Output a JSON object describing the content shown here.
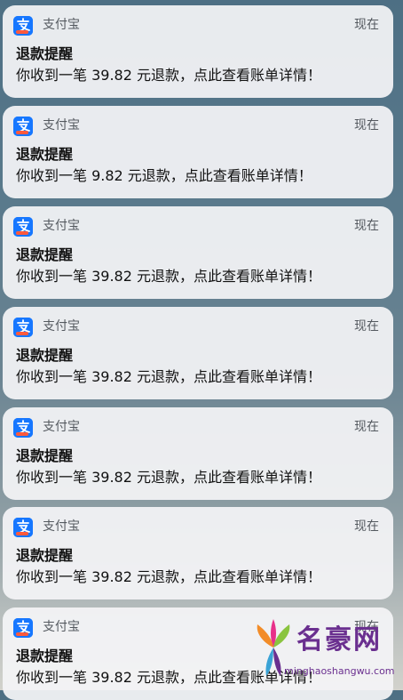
{
  "notifications": [
    {
      "app": "支付宝",
      "time": "现在",
      "title": "退款提醒",
      "body": "你收到一笔 39.82 元退款，点此查看账单详情！"
    },
    {
      "app": "支付宝",
      "time": "现在",
      "title": "退款提醒",
      "body": "你收到一笔 9.82 元退款，点此查看账单详情！"
    },
    {
      "app": "支付宝",
      "time": "现在",
      "title": "退款提醒",
      "body": "你收到一笔 39.82 元退款，点此查看账单详情！"
    },
    {
      "app": "支付宝",
      "time": "现在",
      "title": "退款提醒",
      "body": "你收到一笔 39.82 元退款，点此查看账单详情！"
    },
    {
      "app": "支付宝",
      "time": "现在",
      "title": "退款提醒",
      "body": "你收到一笔 39.82 元退款，点此查看账单详情！"
    },
    {
      "app": "支付宝",
      "time": "现在",
      "title": "退款提醒",
      "body": "你收到一笔 39.82 元退款，点此查看账单详情！"
    },
    {
      "app": "支付宝",
      "time": "现在",
      "title": "退款提醒",
      "body": "你收到一笔 39.82 元退款，点此查看账单详情！"
    }
  ],
  "icons": {
    "app_icon": "alipay-icon"
  },
  "colors": {
    "alipay_blue": "#1677ff",
    "card_bg": "#f4f4f6",
    "watermark_purple": "#6a2f8f"
  },
  "watermark": {
    "name": "名豪网",
    "url": "minghaoshangwu.com"
  }
}
